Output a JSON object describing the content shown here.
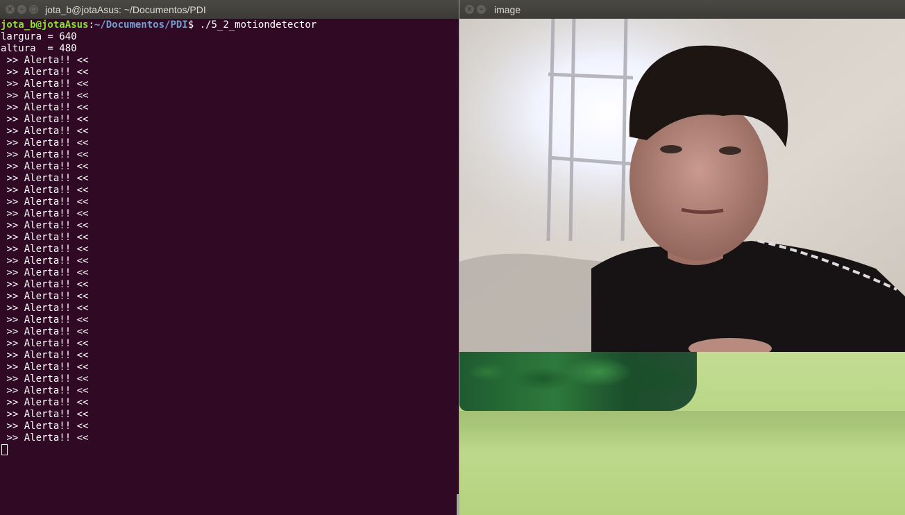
{
  "terminal": {
    "title": "jota_b@jotaAsus: ~/Documentos/PDI",
    "prompt_user": "jota_b@jotaAsus",
    "prompt_sep": ":",
    "prompt_path": "~/Documentos/PDI",
    "prompt_symbol": "$",
    "command": " ./5_2_motiondetector",
    "output": [
      "largura = 640",
      "altura  = 480",
      " >> Alerta!! <<",
      " >> Alerta!! <<",
      " >> Alerta!! <<",
      " >> Alerta!! <<",
      " >> Alerta!! <<",
      " >> Alerta!! <<",
      " >> Alerta!! <<",
      " >> Alerta!! <<",
      " >> Alerta!! <<",
      " >> Alerta!! <<",
      " >> Alerta!! <<",
      " >> Alerta!! <<",
      " >> Alerta!! <<",
      " >> Alerta!! <<",
      " >> Alerta!! <<",
      " >> Alerta!! <<",
      " >> Alerta!! <<",
      " >> Alerta!! <<",
      " >> Alerta!! <<",
      " >> Alerta!! <<",
      " >> Alerta!! <<",
      " >> Alerta!! <<",
      " >> Alerta!! <<",
      " >> Alerta!! <<",
      " >> Alerta!! <<",
      " >> Alerta!! <<",
      " >> Alerta!! <<",
      " >> Alerta!! <<",
      " >> Alerta!! <<",
      " >> Alerta!! <<",
      " >> Alerta!! <<",
      " >> Alerta!! <<",
      " >> Alerta!! <<"
    ]
  },
  "image_window": {
    "title": "image"
  },
  "window_controls": {
    "close_icon": "close-icon",
    "minimize_icon": "minimize-icon",
    "maximize_icon": "maximize-icon"
  },
  "colors": {
    "terminal_bg": "#300a24",
    "prompt_user": "#8ae234",
    "prompt_path": "#729fcf",
    "titlebar": "#3c3b37"
  }
}
